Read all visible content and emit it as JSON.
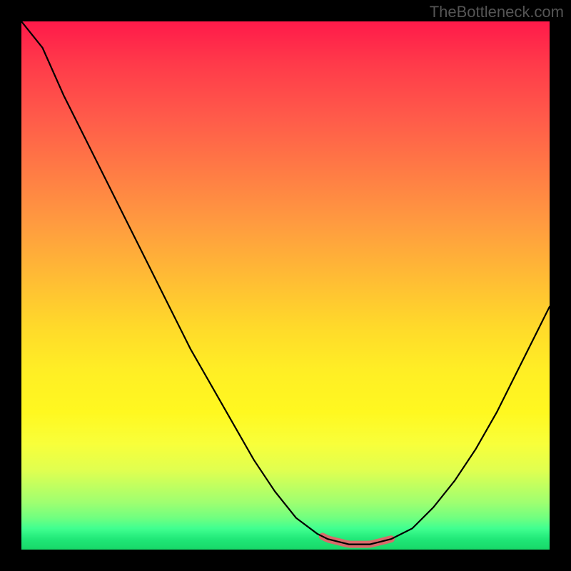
{
  "watermark": "TheBottleneck.com",
  "chart_data": {
    "type": "line",
    "title": "",
    "xlabel": "",
    "ylabel": "",
    "x": [
      0.0,
      0.04,
      0.08,
      0.12,
      0.16,
      0.2,
      0.24,
      0.28,
      0.32,
      0.36,
      0.4,
      0.44,
      0.48,
      0.52,
      0.56,
      0.58,
      0.6,
      0.62,
      0.64,
      0.66,
      0.68,
      0.7,
      0.74,
      0.78,
      0.82,
      0.86,
      0.9,
      0.94,
      0.98,
      1.0
    ],
    "values": [
      1.0,
      0.95,
      0.86,
      0.78,
      0.7,
      0.62,
      0.54,
      0.46,
      0.38,
      0.31,
      0.24,
      0.17,
      0.11,
      0.06,
      0.03,
      0.02,
      0.015,
      0.01,
      0.01,
      0.01,
      0.015,
      0.02,
      0.04,
      0.08,
      0.13,
      0.19,
      0.26,
      0.34,
      0.42,
      0.46
    ],
    "accent_range_x": [
      0.57,
      0.7
    ],
    "xlim": [
      0,
      1
    ],
    "ylim": [
      0,
      1
    ],
    "background_gradient_meaning": "bottleneck severity (red=high, green=low)"
  }
}
